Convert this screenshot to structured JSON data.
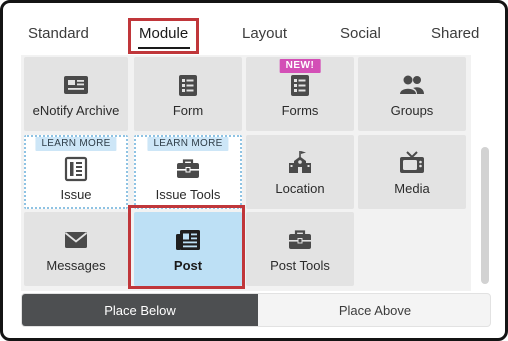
{
  "tabs": [
    {
      "label": "Standard"
    },
    {
      "label": "Module",
      "active": true
    },
    {
      "label": "Layout"
    },
    {
      "label": "Social"
    },
    {
      "label": "Shared"
    }
  ],
  "tiles": [
    {
      "label": "eNotify Archive",
      "icon": "newsletter-card-icon"
    },
    {
      "label": "Form",
      "icon": "form-icon"
    },
    {
      "label": "Forms",
      "icon": "forms-icon",
      "badge": "NEW!"
    },
    {
      "label": "Groups",
      "icon": "groups-icon"
    },
    {
      "label": "Issue",
      "icon": "issue-icon",
      "badge": "LEARN MORE"
    },
    {
      "label": "Issue Tools",
      "icon": "briefcase-icon",
      "badge": "LEARN MORE"
    },
    {
      "label": "Location",
      "icon": "school-building-icon"
    },
    {
      "label": "Media",
      "icon": "tv-icon"
    },
    {
      "label": "Messages",
      "icon": "envelope-icon"
    },
    {
      "label": "Post",
      "icon": "newspaper-icon",
      "selected": true
    },
    {
      "label": "Post Tools",
      "icon": "briefcase-icon"
    }
  ],
  "footer": {
    "place_below": "Place Below",
    "place_above": "Place Above",
    "active": "Place Below"
  },
  "colors": {
    "highlight_box": "#c0363a",
    "selected_tile": "#bde0f5",
    "new_badge": "#d34fb6",
    "learn_badge": "#cde6f7",
    "active_segment": "#4d4f51"
  }
}
